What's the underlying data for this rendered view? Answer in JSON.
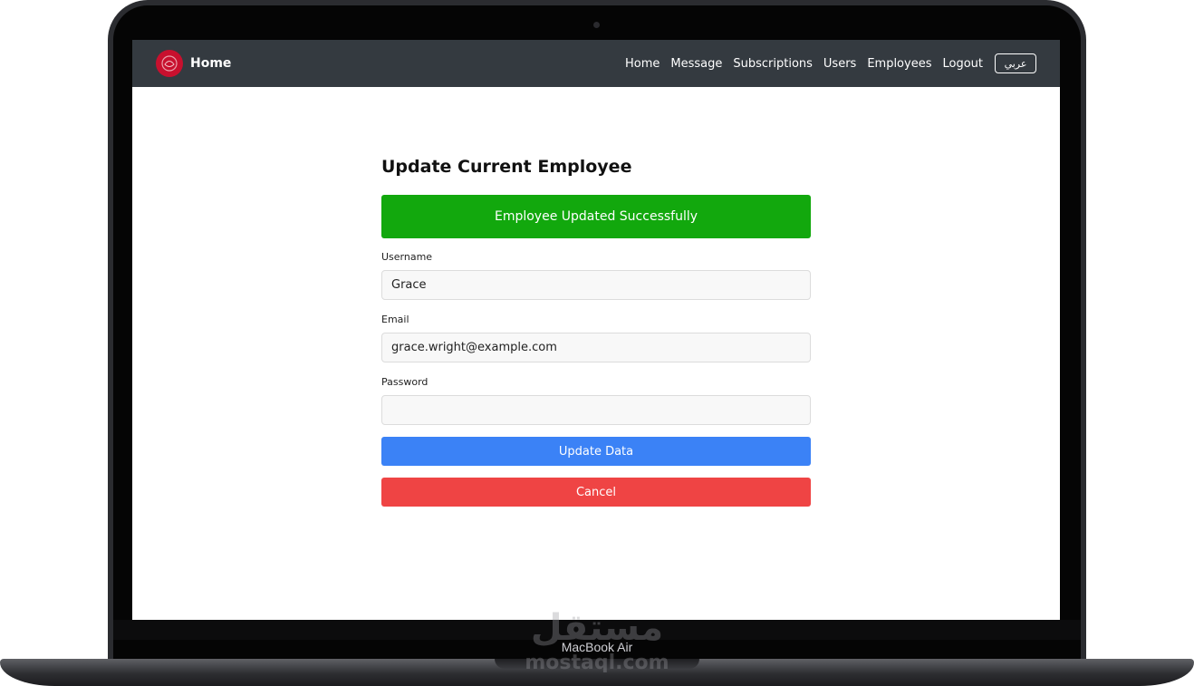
{
  "navbar": {
    "brand_label": "Home",
    "links": [
      {
        "label": "Home"
      },
      {
        "label": "Message"
      },
      {
        "label": "Subscriptions"
      },
      {
        "label": "Users"
      },
      {
        "label": "Employees"
      },
      {
        "label": "Logout"
      }
    ],
    "language_button": "عربي"
  },
  "page": {
    "title": "Update Current Employee",
    "alert": "Employee Updated Successfully"
  },
  "form": {
    "username": {
      "label": "Username",
      "value": "Grace"
    },
    "email": {
      "label": "Email",
      "value": "grace.wright@example.com"
    },
    "password": {
      "label": "Password",
      "value": ""
    },
    "update_button": "Update Data",
    "cancel_button": "Cancel"
  },
  "device": {
    "label": "MacBook Air",
    "watermark_arabic": "مستقل",
    "watermark_latin": "mostaql.com"
  },
  "colors": {
    "navbar_bg": "#343a40",
    "alert_success": "#12a80d",
    "primary": "#3b82f6",
    "danger": "#ef4444",
    "brand_logo": "#c8102e"
  }
}
